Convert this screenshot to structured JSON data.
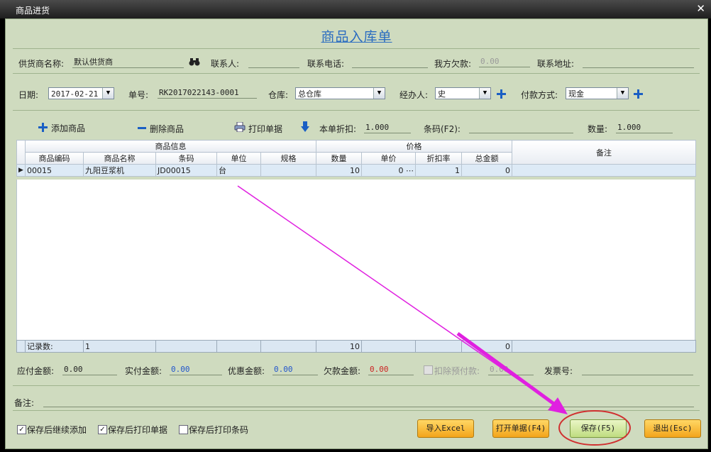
{
  "window": {
    "title": "商品进货",
    "close": "✕"
  },
  "form_title": "商品入库单",
  "row1": {
    "supplier_label": "供货商名称:",
    "supplier_value": "默认供货商",
    "contact_label": "联系人:",
    "contact_value": "",
    "phone_label": "联系电话:",
    "phone_value": "",
    "debt_label": "我方欠款:",
    "debt_value": "0.00",
    "address_label": "联系地址:",
    "address_value": ""
  },
  "row2": {
    "date_label": "日期:",
    "date_value": "2017-02-21",
    "order_label": "单号:",
    "order_value": "RK2017022143-0001",
    "warehouse_label": "仓库:",
    "warehouse_value": "总仓库",
    "handler_label": "经办人:",
    "handler_value": "史",
    "payment_label": "付款方式:",
    "payment_value": "现金"
  },
  "toolbar": {
    "add_label": "添加商品",
    "delete_label": "删除商品",
    "print_label": "打印单据",
    "discount_label": "本单折扣:",
    "discount_value": "1.000",
    "barcode_label": "条码(F2):",
    "barcode_value": "",
    "qty_label": "数量:",
    "qty_value": "1.000"
  },
  "grid": {
    "group_info": "商品信息",
    "group_price": "价格",
    "remark": "备注",
    "columns": {
      "code": "商品编码",
      "name": "商品名称",
      "barcode": "条码",
      "unit": "单位",
      "spec": "规格",
      "qty": "数量",
      "price": "单价",
      "rate": "折扣率",
      "total": "总金额"
    },
    "rows": [
      {
        "code": "00015",
        "name": "九阳豆浆机",
        "barcode": "JD00015",
        "unit": "台",
        "spec": "",
        "qty": "10",
        "price": "0",
        "rate": "1",
        "total": "0",
        "remark": ""
      }
    ],
    "footer": {
      "label": "记录数:",
      "count": "1",
      "qty": "10",
      "total": "0"
    }
  },
  "amounts": {
    "payable_label": "应付金额:",
    "payable_value": "0.00",
    "paid_label": "实付金额:",
    "paid_value": "0.00",
    "discount_label": "优惠金额:",
    "discount_value": "0.00",
    "owed_label": "欠款金额:",
    "owed_value": "0.00",
    "deduct_label": "扣除预付款:",
    "deduct_value": "0.00",
    "invoice_label": "发票号:",
    "invoice_value": ""
  },
  "remark_label": "备注:",
  "options": {
    "continue_add": "保存后继续添加",
    "print_doc": "保存后打印单据",
    "print_barcode": "保存后打印条码"
  },
  "buttons": {
    "import": "导入Excel",
    "open": "打开单据(F4)",
    "save": "保存(F5)",
    "exit": "退出(Esc)"
  },
  "colors": {
    "accent": "#1a5fc4",
    "annotation": "#e020e0",
    "highlight_circle": "#d03030"
  }
}
